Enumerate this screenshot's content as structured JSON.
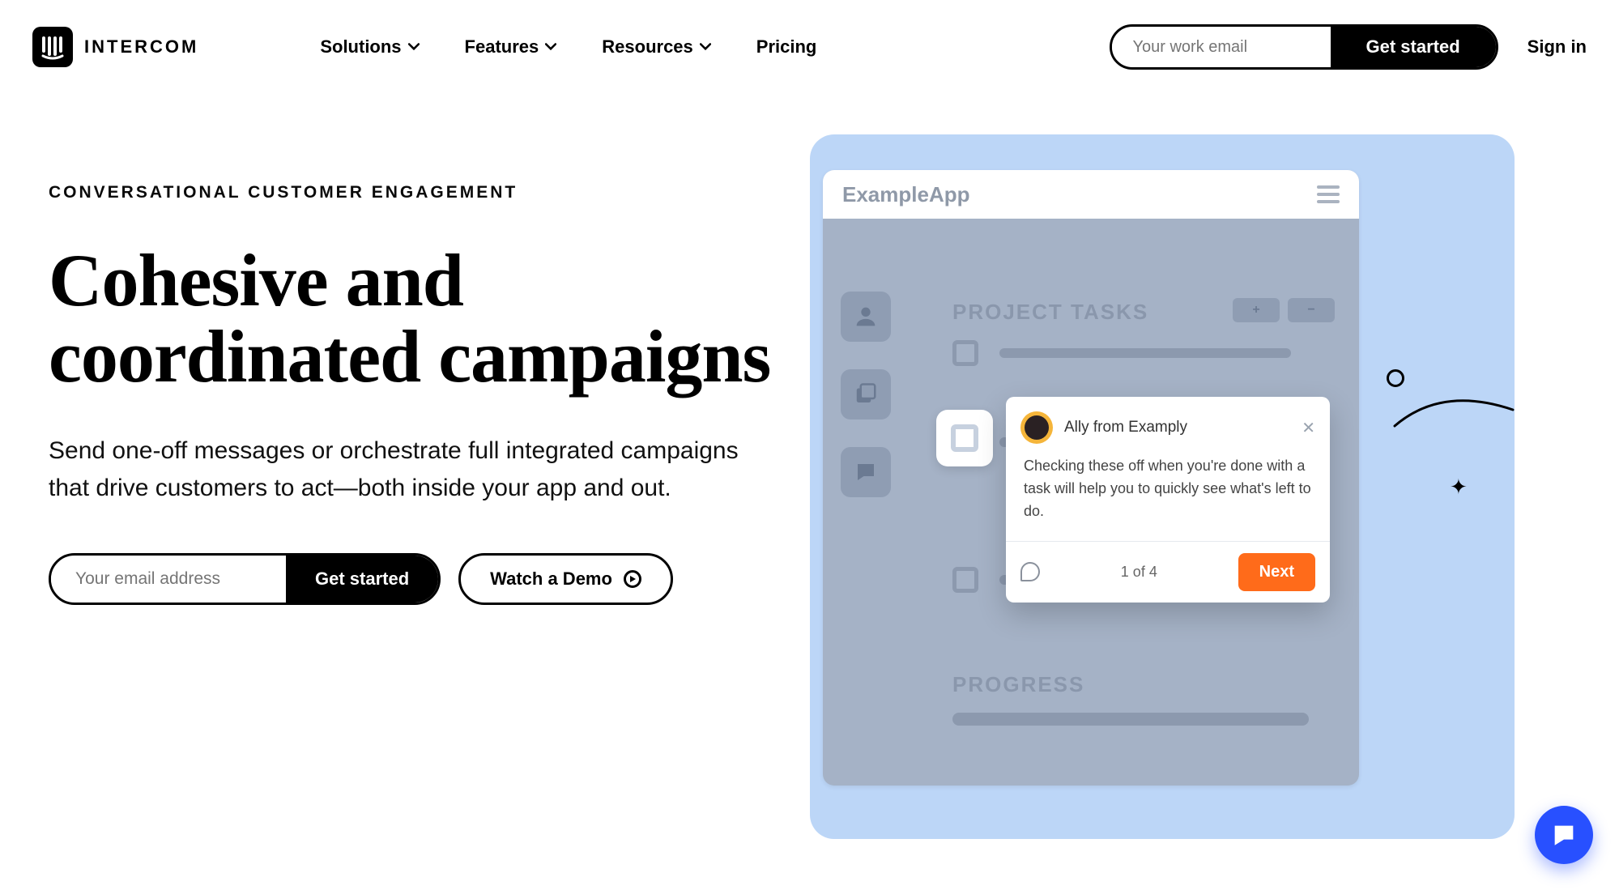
{
  "brand": {
    "name": "INTERCOM"
  },
  "nav": {
    "items": [
      {
        "label": "Solutions",
        "has_dropdown": true
      },
      {
        "label": "Features",
        "has_dropdown": true
      },
      {
        "label": "Resources",
        "has_dropdown": true
      },
      {
        "label": "Pricing",
        "has_dropdown": false
      }
    ]
  },
  "header_form": {
    "placeholder": "Your work email",
    "cta": "Get started"
  },
  "signin": "Sign in",
  "hero": {
    "eyebrow": "CONVERSATIONAL CUSTOMER ENGAGEMENT",
    "headline": "Cohesive and coordinated campaigns",
    "subhead": "Send one-off messages or orchestrate full integrated campaigns that drive customers to act—both inside your app and out.",
    "email_placeholder": "Your email address",
    "email_cta": "Get started",
    "demo_cta": "Watch a Demo"
  },
  "illustration": {
    "app_title": "ExampleApp",
    "section_tasks": "PROJECT TASKS",
    "section_progress": "PROGRESS",
    "tooltip": {
      "author": "Ally from Examply",
      "body": "Checking these off when you're done with a task will help you to quickly see what's left to do.",
      "step": "1 of 4",
      "next": "Next"
    },
    "pill_plus": "+",
    "pill_minus": "−"
  }
}
